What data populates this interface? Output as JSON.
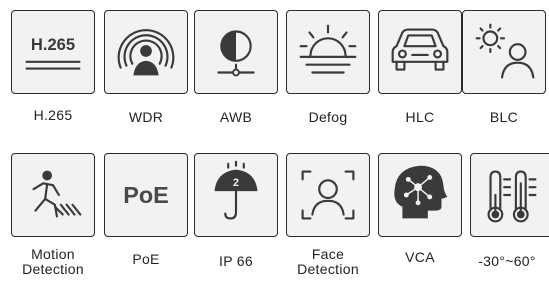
{
  "features_row1": [
    {
      "label": "H.265",
      "icon_text": "H.265"
    },
    {
      "label": "WDR"
    },
    {
      "label": "AWB"
    },
    {
      "label": "Defog"
    },
    {
      "label": "HLC"
    },
    {
      "label": "BLC"
    }
  ],
  "features_row2": [
    {
      "label_line1": "Motion",
      "label_line2": "Detection"
    },
    {
      "label": "PoE",
      "icon_text": "PoE"
    },
    {
      "label": "IP 66",
      "icon_text": "2"
    },
    {
      "label_line1": "Face",
      "label_line2": "Detection"
    },
    {
      "label": "VCA"
    },
    {
      "label": "-30°~60°"
    }
  ],
  "icons": [
    "h265-icon",
    "wdr-icon",
    "awb-icon",
    "defog-icon",
    "hlc-car-icon",
    "blc-icon",
    "motion-detection-icon",
    "poe-icon",
    "ip66-umbrella-icon",
    "face-detection-icon",
    "vca-head-icon",
    "thermometer-icon"
  ],
  "colors": {
    "tile_border": "#2b2b2b",
    "tile_bg": "#f2f2f2",
    "icon": "#3a3a3a",
    "text": "#222222"
  }
}
